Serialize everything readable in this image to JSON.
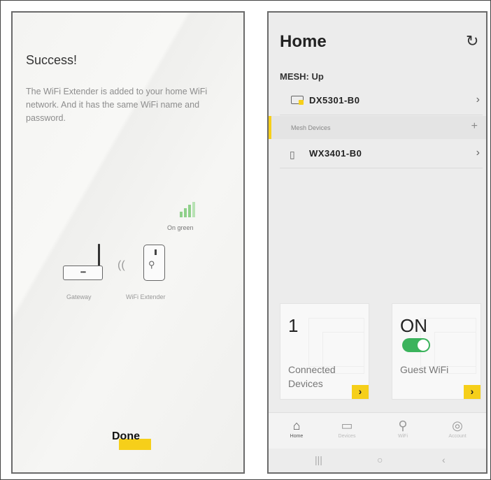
{
  "left_screen": {
    "title": "Success!",
    "description": "The WiFi Extender is added to your home WiFi network. And it has the same WiFi name and password.",
    "diagram": {
      "gateway_label": "Gateway",
      "extender_label": "WiFi Extender",
      "status_label": "On green",
      "router_dots": "••••"
    },
    "done_label": "Done"
  },
  "right_screen": {
    "title": "Home",
    "mesh_status": "MESH: Up",
    "gateway_device": "DX5301-B0",
    "mesh_section_label": "Mesh Devices",
    "mesh_device": "WX3401-B0",
    "cards": {
      "connected": {
        "value": "1",
        "label": "Connected Devices"
      },
      "guest": {
        "value": "ON",
        "label": "Guest WiFi",
        "toggle_on": true
      }
    },
    "nav": [
      {
        "label": "Home",
        "icon": "home-icon",
        "active": true
      },
      {
        "label": "Devices",
        "icon": "devices-icon",
        "active": false
      },
      {
        "label": "WiFi",
        "icon": "wifi-icon",
        "active": false
      },
      {
        "label": "Account",
        "icon": "account-icon",
        "active": false
      }
    ],
    "system_nav": {
      "recent": "|||",
      "home": "○",
      "back": "‹"
    }
  },
  "colors": {
    "accent": "#f6cf1a",
    "toggle_on": "#3bb35c",
    "signal_green": "#8fd08a"
  }
}
